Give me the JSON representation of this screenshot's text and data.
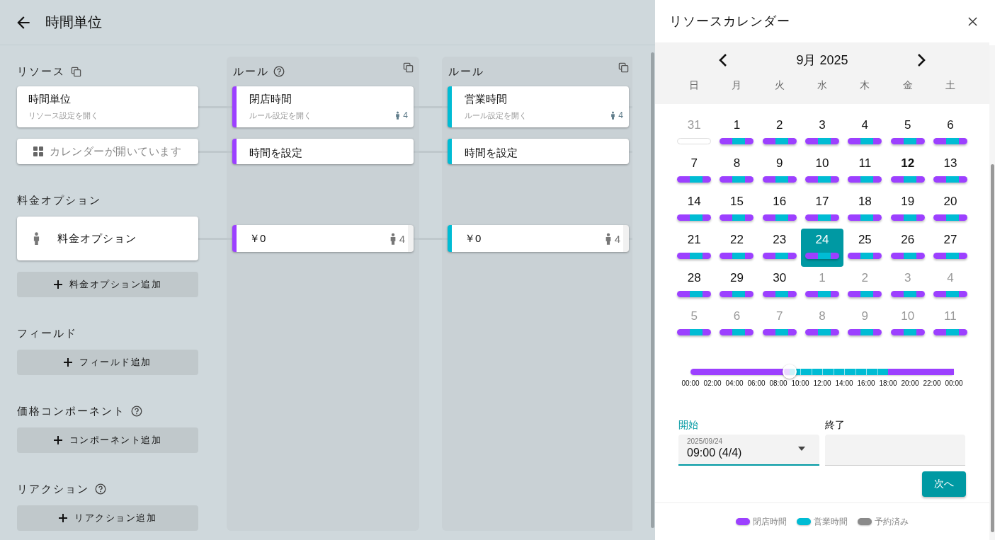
{
  "header": {
    "title": "時間単位"
  },
  "resource_column": {
    "heading": "リソース",
    "card": {
      "title": "時間単位",
      "subtitle": "リソース設定を開く"
    },
    "calendar_status": "カレンダーが開いています"
  },
  "pricing": {
    "heading": "料金オプション",
    "option": "料金オプション",
    "add_button": "料金オプション追加"
  },
  "sections": [
    {
      "heading": "フィールド",
      "help": false,
      "add_button": "フィールド追加"
    },
    {
      "heading": "価格コンポーネント",
      "help": true,
      "add_button": "コンポーネント追加"
    },
    {
      "heading": "リアクション",
      "help": true,
      "add_button": "リアクション追加"
    }
  ],
  "rule_columns": [
    {
      "heading": "ルール",
      "help": true,
      "color": "#9c40ff",
      "card": {
        "title": "閉店時間",
        "subtitle": "ルール設定を開く",
        "count": "4"
      },
      "time_card": "時間を設定",
      "price": {
        "value": "￥0",
        "count": "4"
      }
    },
    {
      "heading": "ルール",
      "help": false,
      "color": "#00bcd4",
      "card": {
        "title": "営業時間",
        "subtitle": "ルール設定を開く",
        "count": "4"
      },
      "time_card": "時間を設定",
      "price": {
        "value": "￥0",
        "count": "4"
      }
    }
  ],
  "calendar": {
    "title": "リソースカレンダー",
    "month": "9月 2025",
    "weekdays": [
      "日",
      "月",
      "火",
      "水",
      "木",
      "金",
      "土"
    ],
    "days": [
      {
        "label": "31",
        "other_month": true,
        "selected": false,
        "today": false,
        "kind": "none"
      },
      {
        "label": "1",
        "other_month": false,
        "selected": false,
        "today": false,
        "kind": "hours"
      },
      {
        "label": "2",
        "other_month": false,
        "selected": false,
        "today": false,
        "kind": "hours"
      },
      {
        "label": "3",
        "other_month": false,
        "selected": false,
        "today": false,
        "kind": "hours"
      },
      {
        "label": "4",
        "other_month": false,
        "selected": false,
        "today": false,
        "kind": "hours"
      },
      {
        "label": "5",
        "other_month": false,
        "selected": false,
        "today": false,
        "kind": "hours"
      },
      {
        "label": "6",
        "other_month": false,
        "selected": false,
        "today": false,
        "kind": "hours"
      },
      {
        "label": "7",
        "other_month": false,
        "selected": false,
        "today": false,
        "kind": "hours"
      },
      {
        "label": "8",
        "other_month": false,
        "selected": false,
        "today": false,
        "kind": "hours"
      },
      {
        "label": "9",
        "other_month": false,
        "selected": false,
        "today": false,
        "kind": "hours"
      },
      {
        "label": "10",
        "other_month": false,
        "selected": false,
        "today": false,
        "kind": "hours"
      },
      {
        "label": "11",
        "other_month": false,
        "selected": false,
        "today": false,
        "kind": "hours"
      },
      {
        "label": "12",
        "other_month": false,
        "selected": false,
        "today": true,
        "kind": "hours"
      },
      {
        "label": "13",
        "other_month": false,
        "selected": false,
        "today": false,
        "kind": "hours"
      },
      {
        "label": "14",
        "other_month": false,
        "selected": false,
        "today": false,
        "kind": "hours"
      },
      {
        "label": "15",
        "other_month": false,
        "selected": false,
        "today": false,
        "kind": "hours"
      },
      {
        "label": "16",
        "other_month": false,
        "selected": false,
        "today": false,
        "kind": "hours"
      },
      {
        "label": "17",
        "other_month": false,
        "selected": false,
        "today": false,
        "kind": "hours"
      },
      {
        "label": "18",
        "other_month": false,
        "selected": false,
        "today": false,
        "kind": "hours"
      },
      {
        "label": "19",
        "other_month": false,
        "selected": false,
        "today": false,
        "kind": "hours"
      },
      {
        "label": "20",
        "other_month": false,
        "selected": false,
        "today": false,
        "kind": "hours"
      },
      {
        "label": "21",
        "other_month": false,
        "selected": false,
        "today": false,
        "kind": "hours"
      },
      {
        "label": "22",
        "other_month": false,
        "selected": false,
        "today": false,
        "kind": "hours"
      },
      {
        "label": "23",
        "other_month": false,
        "selected": false,
        "today": false,
        "kind": "hours"
      },
      {
        "label": "24",
        "other_month": false,
        "selected": true,
        "today": false,
        "kind": "hours"
      },
      {
        "label": "25",
        "other_month": false,
        "selected": false,
        "today": false,
        "kind": "hours"
      },
      {
        "label": "26",
        "other_month": false,
        "selected": false,
        "today": false,
        "kind": "hours"
      },
      {
        "label": "27",
        "other_month": false,
        "selected": false,
        "today": false,
        "kind": "hours"
      },
      {
        "label": "28",
        "other_month": false,
        "selected": false,
        "today": false,
        "kind": "hours"
      },
      {
        "label": "29",
        "other_month": false,
        "selected": false,
        "today": false,
        "kind": "hours"
      },
      {
        "label": "30",
        "other_month": false,
        "selected": false,
        "today": false,
        "kind": "hours"
      },
      {
        "label": "1",
        "other_month": true,
        "selected": false,
        "today": false,
        "kind": "hours"
      },
      {
        "label": "2",
        "other_month": true,
        "selected": false,
        "today": false,
        "kind": "hours"
      },
      {
        "label": "3",
        "other_month": true,
        "selected": false,
        "today": false,
        "kind": "hours"
      },
      {
        "label": "4",
        "other_month": true,
        "selected": false,
        "today": false,
        "kind": "hours"
      },
      {
        "label": "5",
        "other_month": true,
        "selected": false,
        "today": false,
        "kind": "hours"
      },
      {
        "label": "6",
        "other_month": true,
        "selected": false,
        "today": false,
        "kind": "hours"
      },
      {
        "label": "7",
        "other_month": true,
        "selected": false,
        "today": false,
        "kind": "hours"
      },
      {
        "label": "8",
        "other_month": true,
        "selected": false,
        "today": false,
        "kind": "hours"
      },
      {
        "label": "9",
        "other_month": true,
        "selected": false,
        "today": false,
        "kind": "hours"
      },
      {
        "label": "10",
        "other_month": true,
        "selected": false,
        "today": false,
        "kind": "hours"
      },
      {
        "label": "11",
        "other_month": true,
        "selected": false,
        "today": false,
        "kind": "hours"
      }
    ],
    "timeline": {
      "level": 0.375,
      "slots": [
        {
          "kind": "closed"
        },
        {
          "kind": "closed"
        },
        {
          "kind": "closed"
        },
        {
          "kind": "closed"
        },
        {
          "kind": "closed"
        },
        {
          "kind": "closed"
        },
        {
          "kind": "closed"
        },
        {
          "kind": "closed"
        },
        {
          "kind": "closed"
        },
        {
          "kind": "open"
        },
        {
          "kind": "open"
        },
        {
          "kind": "open"
        },
        {
          "kind": "open"
        },
        {
          "kind": "open"
        },
        {
          "kind": "open"
        },
        {
          "kind": "open"
        },
        {
          "kind": "open"
        },
        {
          "kind": "open"
        },
        {
          "kind": "closed"
        },
        {
          "kind": "closed"
        },
        {
          "kind": "closed"
        },
        {
          "kind": "closed"
        },
        {
          "kind": "closed"
        },
        {
          "kind": "closed"
        }
      ],
      "ticks": [
        "00:00",
        "02:00",
        "04:00",
        "06:00",
        "08:00",
        "10:00",
        "12:00",
        "14:00",
        "16:00",
        "18:00",
        "20:00",
        "22:00",
        "00:00"
      ]
    },
    "start": {
      "label": "開始",
      "focused": true,
      "date": "2025/09/24",
      "value": "09:00 (4/4)"
    },
    "end": {
      "label": "終了"
    },
    "next_button": "次へ",
    "legend": [
      {
        "label": "閉店時間",
        "color": "#9c40ff"
      },
      {
        "label": "営業時間",
        "color": "#00bcd4"
      },
      {
        "label": "予約済み",
        "color": "#8a8a8a"
      }
    ]
  }
}
